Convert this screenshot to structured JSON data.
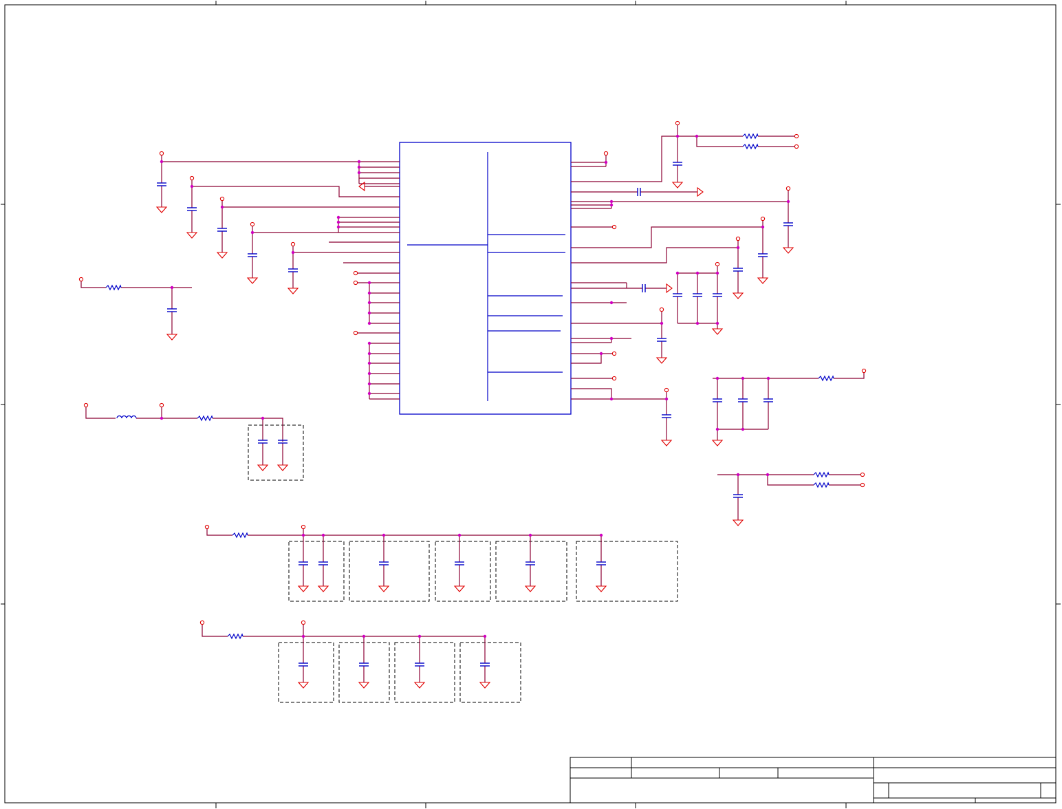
{
  "colors": {
    "wire": "#8b0033",
    "component": "#0000c8",
    "ground": "#e00000",
    "junction": "#d000c0",
    "border": "#000000",
    "background": "#ffffff"
  },
  "symbols": [
    "capacitor",
    "resistor",
    "inductor",
    "ground-symbol",
    "power-port",
    "junction-dot"
  ],
  "title_block": {
    "title": "",
    "size": "",
    "document_number": "",
    "revision": "",
    "date": "",
    "sheet": ""
  }
}
